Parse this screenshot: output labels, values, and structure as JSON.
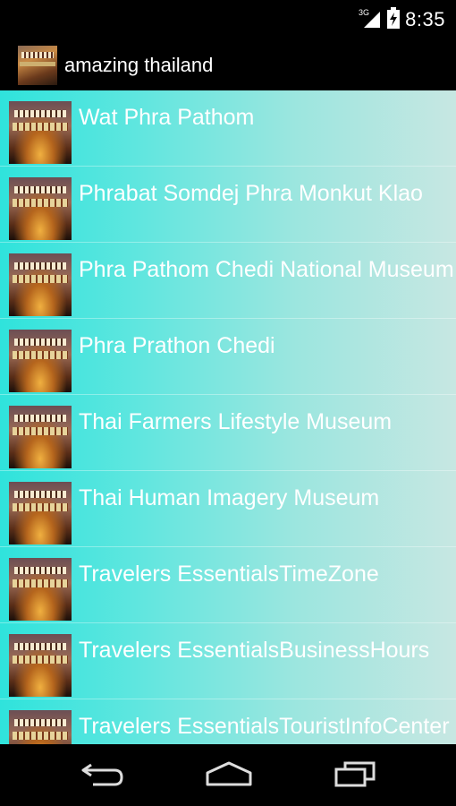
{
  "status_bar": {
    "time": "8:35",
    "network_label": "3G"
  },
  "action_bar": {
    "title": "amazing thailand"
  },
  "list": {
    "items": [
      {
        "label": "Wat Phra Pathom"
      },
      {
        "label": "Phrabat Somdej Phra Monkut Klao"
      },
      {
        "label": "Phra Pathom Chedi National Museum"
      },
      {
        "label": "Phra Prathon Chedi"
      },
      {
        "label": "Thai Farmers Lifestyle Museum"
      },
      {
        "label": "Thai Human Imagery Museum"
      },
      {
        "label": "Travelers EssentialsTimeZone"
      },
      {
        "label": "Travelers EssentialsBusinessHours"
      },
      {
        "label": "Travelers EssentialsTouristInfoCenter"
      }
    ]
  },
  "nav_bar": {
    "buttons": [
      "back-icon",
      "home-icon",
      "recent-apps-icon"
    ]
  }
}
